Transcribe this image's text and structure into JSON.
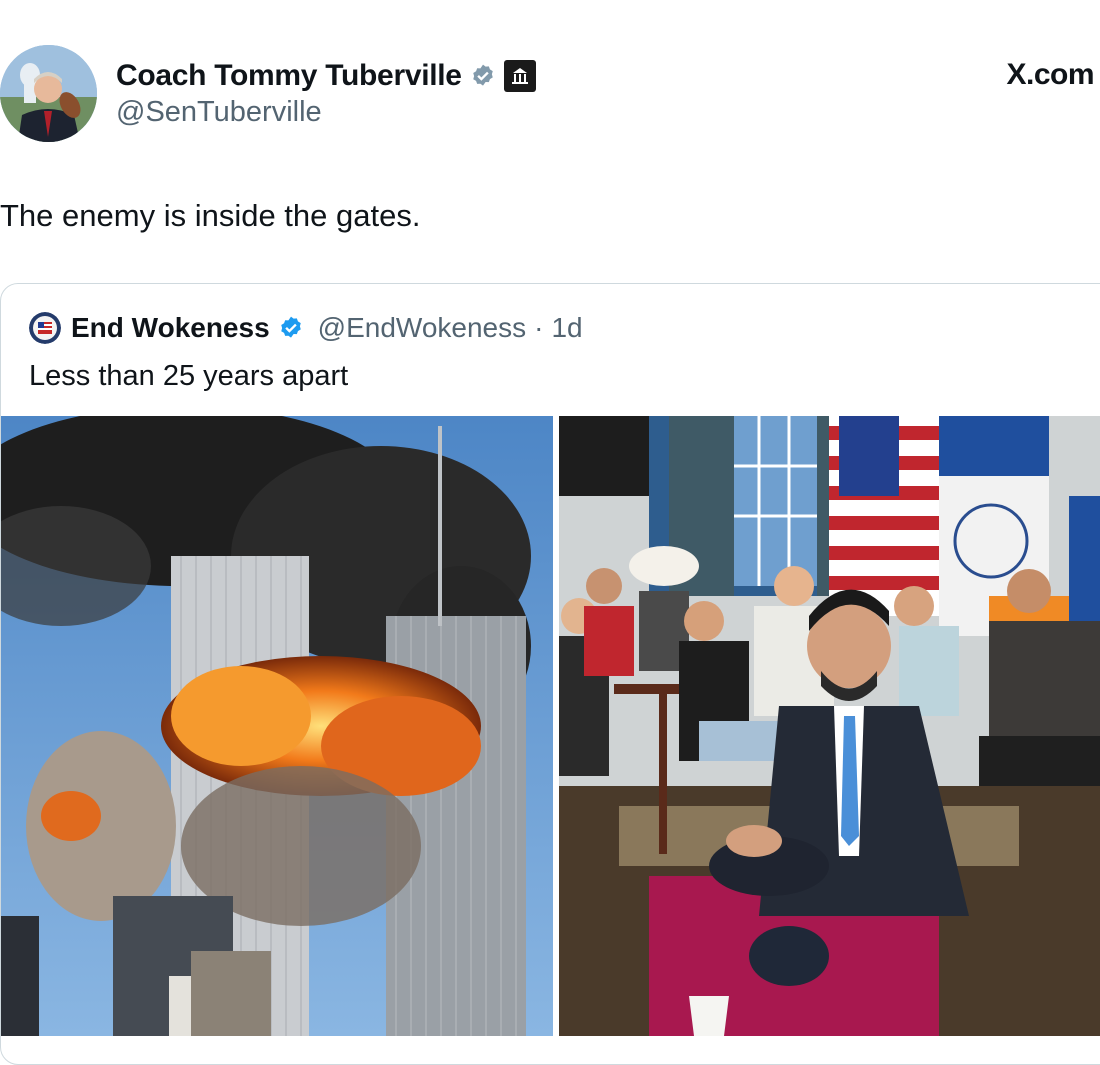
{
  "author": {
    "name": "Coach Tommy Tuberville",
    "handle": "@SenTuberville",
    "verified_icon": "verified-badge-gray-icon",
    "affiliation_icon": "government-building-icon"
  },
  "site_label": "X.com",
  "tweet": {
    "text": "The enemy is inside the gates."
  },
  "quoted": {
    "name": "End Wokeness",
    "handle": "@EndWokeness",
    "separator": "·",
    "time": "1d",
    "text": "Less than 25 years apart",
    "verified_icon": "verified-badge-blue-icon"
  },
  "media": {
    "left_image": "burning-twin-towers-photo",
    "right_image": "seated-gathering-with-flags-photo"
  },
  "colors": {
    "verified_blue": "#1d9bf0",
    "verified_gray": "#829aab",
    "text": "#0f1419",
    "muted": "#536471"
  }
}
